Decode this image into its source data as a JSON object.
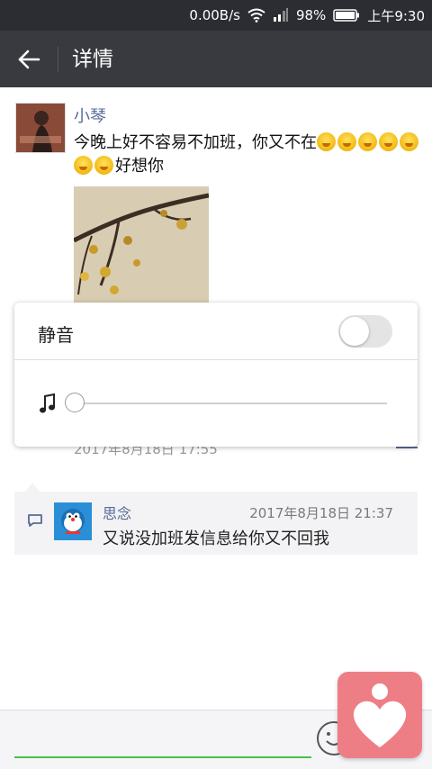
{
  "status_bar": {
    "speed": "0.00B/s",
    "battery": "98%",
    "time": "上午9:30"
  },
  "header": {
    "title": "详情"
  },
  "post": {
    "author": "小琴",
    "text_a": "今晚上好不容易不加班，你又不在",
    "text_b": "好想你",
    "emoji_icon": "crying-face-icon",
    "time_partial": "2017年8月18日 17:55"
  },
  "popup": {
    "mute_label": "静音",
    "mute_on": false,
    "volume_level": 0
  },
  "comment": {
    "author": "思念",
    "time": "2017年8月18日 21:37",
    "text": "又说没加班发信息给你又不回我"
  },
  "colors": {
    "name_blue": "#576b95",
    "titlebar": "#393a3f",
    "fab_pink": "#ee7e86",
    "accent_green": "#46c24a"
  }
}
